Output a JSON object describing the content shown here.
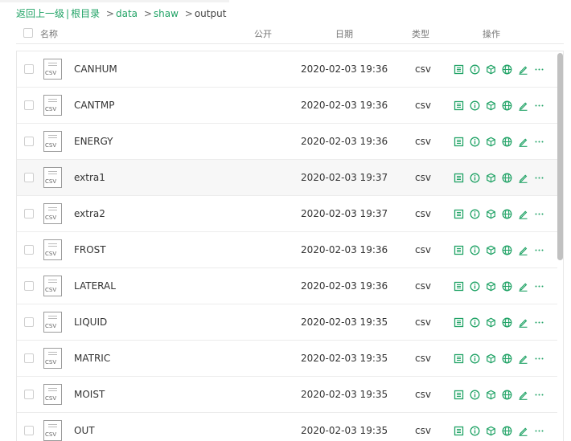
{
  "breadcrumb": {
    "back_label": "返回上一级",
    "separator": "|",
    "root_label": "根目录",
    "arrow": ">",
    "path": [
      "data",
      "shaw"
    ],
    "current": "output"
  },
  "table": {
    "headers": {
      "name": "名称",
      "public": "公开",
      "date": "日期",
      "type": "类型",
      "actions": "操作"
    },
    "file_icon_label": "CSV",
    "accent_color": "#21a366",
    "action_icons": [
      "view-icon",
      "info-icon",
      "cube-icon",
      "globe-icon",
      "edit-icon",
      "more-icon"
    ],
    "rows": [
      {
        "name": "CANHUM",
        "date": "2020-02-03 19:36",
        "type": "csv"
      },
      {
        "name": "CANTMP",
        "date": "2020-02-03 19:36",
        "type": "csv"
      },
      {
        "name": "ENERGY",
        "date": "2020-02-03 19:36",
        "type": "csv"
      },
      {
        "name": "extra1",
        "date": "2020-02-03 19:37",
        "type": "csv",
        "hover": true
      },
      {
        "name": "extra2",
        "date": "2020-02-03 19:37",
        "type": "csv"
      },
      {
        "name": "FROST",
        "date": "2020-02-03 19:36",
        "type": "csv"
      },
      {
        "name": "LATERAL",
        "date": "2020-02-03 19:36",
        "type": "csv"
      },
      {
        "name": "LIQUID",
        "date": "2020-02-03 19:35",
        "type": "csv"
      },
      {
        "name": "MATRIC",
        "date": "2020-02-03 19:35",
        "type": "csv"
      },
      {
        "name": "MOIST",
        "date": "2020-02-03 19:35",
        "type": "csv"
      },
      {
        "name": "OUT",
        "date": "2020-02-03 19:35",
        "type": "csv"
      }
    ]
  }
}
